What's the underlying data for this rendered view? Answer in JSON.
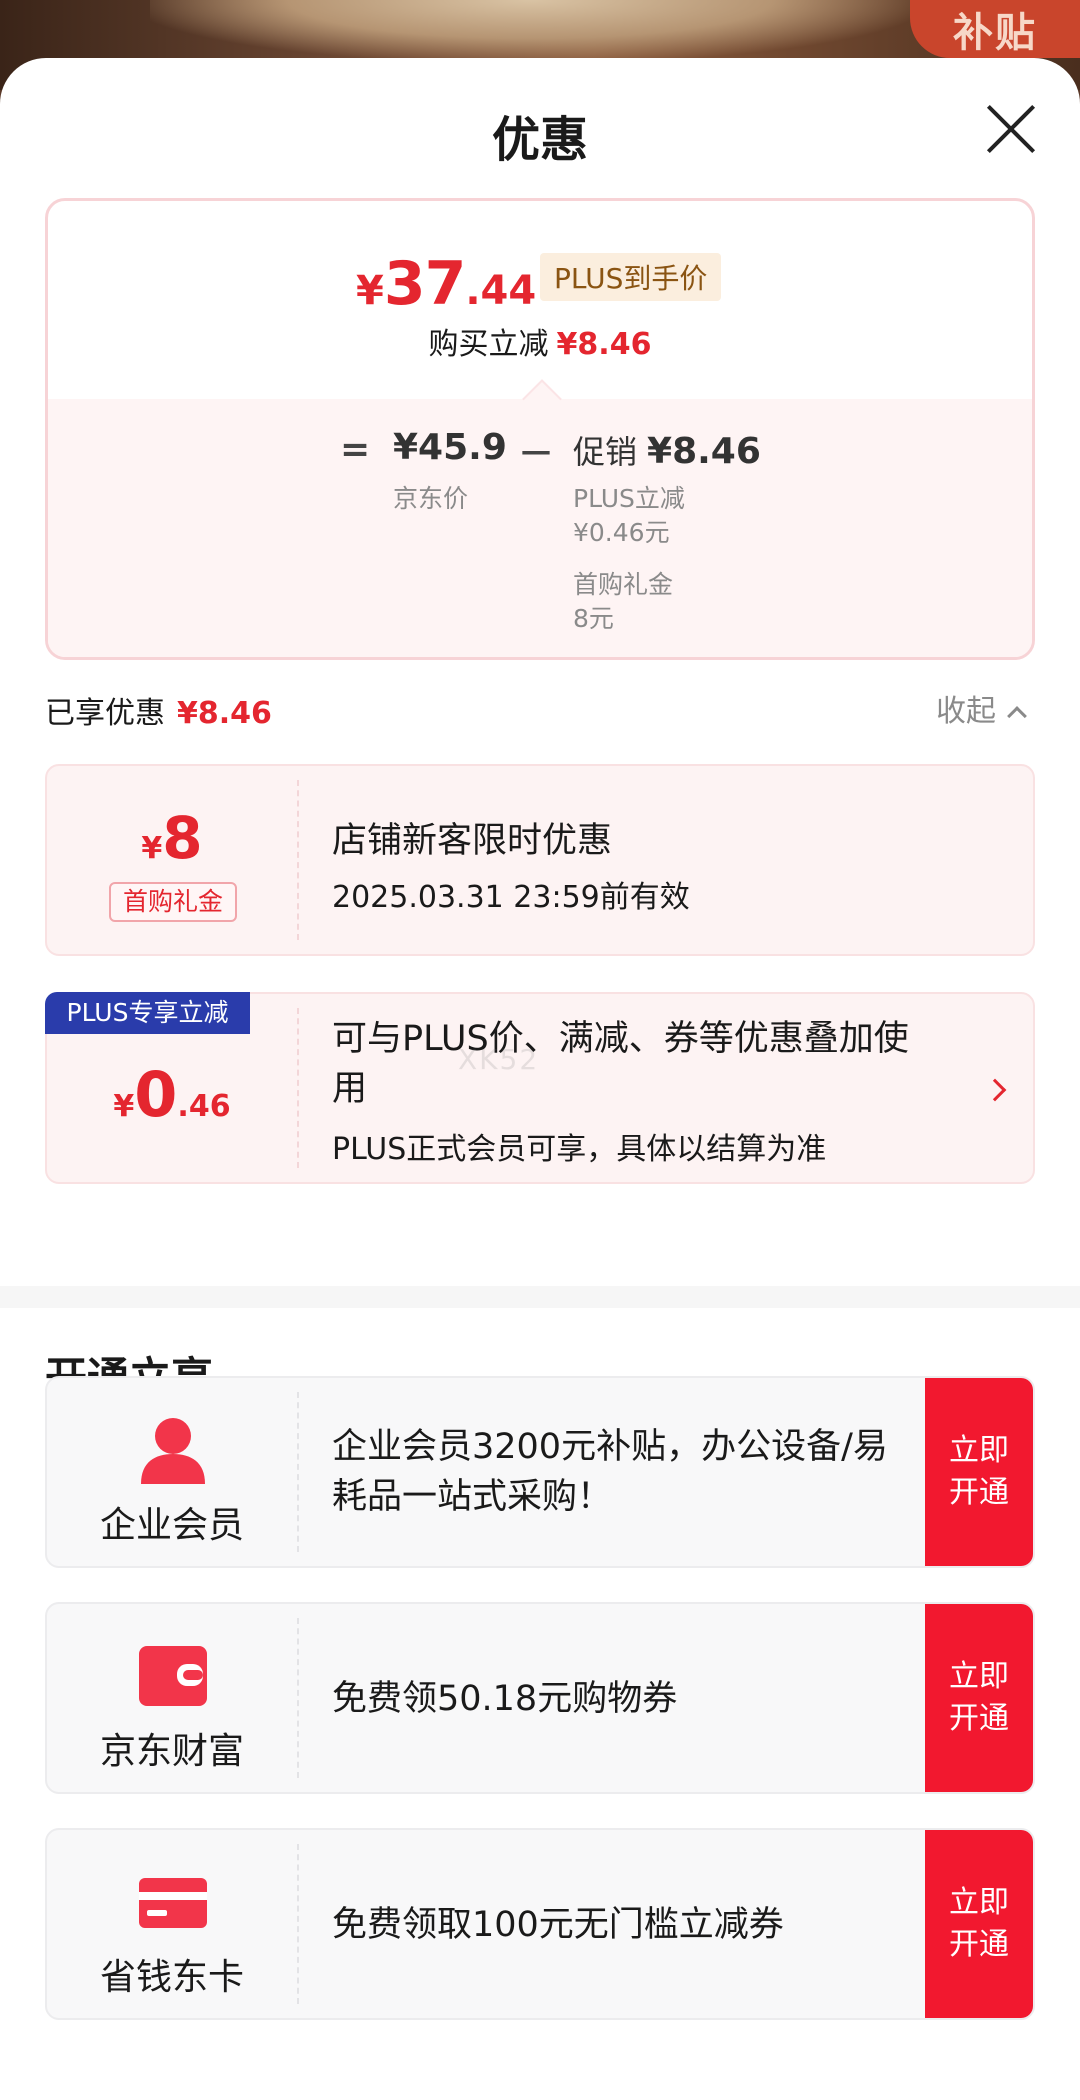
{
  "header": {
    "subsidy_badge": "补贴",
    "title": "优惠"
  },
  "summary": {
    "currency": "¥",
    "final_price_int": "37",
    "final_price_dec": ".44",
    "plus_tag": "PLUS到手价",
    "reduce_label": "购买立减",
    "reduce_amount": "¥8.46",
    "eq": "=",
    "jd_price": "¥45.9",
    "jd_label": "京东价",
    "minus": "－",
    "promo_label": "促销",
    "promo_amount": "¥8.46",
    "plus_reduce_label": "PLUS立减",
    "plus_reduce_amount": "¥0.46元",
    "gift_label": "首购礼金",
    "gift_amount": "8元"
  },
  "enjoyed": {
    "label": "已享优惠",
    "amount": "¥8.46",
    "collapse_label": "收起"
  },
  "coupons": [
    {
      "symbol": "¥",
      "amount": "8",
      "tag": "首购礼金",
      "title": "店铺新客限时优惠",
      "subtitle": "2025.03.31 23:59前有效"
    },
    {
      "ribbon": "PLUS专享立减",
      "symbol": "¥",
      "amount_int": "0",
      "amount_dec": ".46",
      "title": "可与PLUS价、满减、券等优惠叠加使用",
      "subtitle": "PLUS正式会员可享，具体以结算为准"
    }
  ],
  "watermark": "XK52",
  "open_section": {
    "title": "开通立享",
    "items": [
      {
        "name": "企业会员",
        "icon": "person-icon",
        "desc": "企业会员3200元补贴，办公设备/易耗品一站式采购！",
        "button_line1": "立即",
        "button_line2": "开通"
      },
      {
        "name": "京东财富",
        "icon": "wallet-icon",
        "desc": "免费领50.18元购物券",
        "button_line1": "立即",
        "button_line2": "开通"
      },
      {
        "name": "省钱东卡",
        "icon": "card-icon",
        "desc": "免费领取100元无门槛立减券",
        "button_line1": "立即",
        "button_line2": "开通"
      }
    ]
  },
  "colors": {
    "accent_red": "#e4262f",
    "button_red": "#f2182f",
    "plus_blue": "#2a3cab",
    "plus_gold_bg": "#fbeede"
  }
}
